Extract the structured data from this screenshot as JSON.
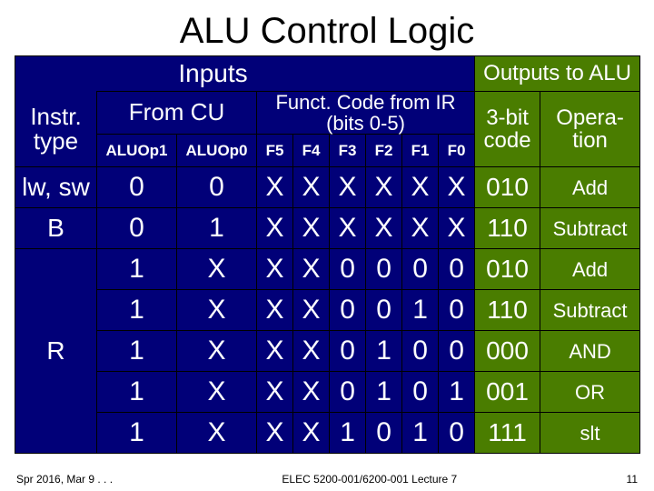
{
  "title": "ALU Control Logic",
  "headers": {
    "inputs": "Inputs",
    "outputs": "Outputs to ALU",
    "instr": "Instr. type",
    "fromcu": "From CU",
    "funct": "Funct. Code from IR (bits 0-5)",
    "aluop1": "ALUOp1",
    "aluop0": "ALUOp0",
    "f5": "F5",
    "f4": "F4",
    "f3": "F3",
    "f2": "F2",
    "f1": "F1",
    "f0": "F0",
    "code3": "3-bit code",
    "oper": "Opera-tion"
  },
  "rows": [
    {
      "instr": "lw, sw",
      "aluop1": "0",
      "aluop0": "0",
      "f5": "X",
      "f4": "X",
      "f3": "X",
      "f2": "X",
      "f1": "X",
      "f0": "X",
      "code": "010",
      "op": "Add"
    },
    {
      "instr": "B",
      "aluop1": "0",
      "aluop0": "1",
      "f5": "X",
      "f4": "X",
      "f3": "X",
      "f2": "X",
      "f1": "X",
      "f0": "X",
      "code": "110",
      "op": "Subtract"
    },
    {
      "instr": "",
      "aluop1": "1",
      "aluop0": "X",
      "f5": "X",
      "f4": "X",
      "f3": "0",
      "f2": "0",
      "f1": "0",
      "f0": "0",
      "code": "010",
      "op": "Add"
    },
    {
      "instr": "",
      "aluop1": "1",
      "aluop0": "X",
      "f5": "X",
      "f4": "X",
      "f3": "0",
      "f2": "0",
      "f1": "1",
      "f0": "0",
      "code": "110",
      "op": "Subtract"
    },
    {
      "instr": "R",
      "aluop1": "1",
      "aluop0": "X",
      "f5": "X",
      "f4": "X",
      "f3": "0",
      "f2": "1",
      "f1": "0",
      "f0": "0",
      "code": "000",
      "op": "AND"
    },
    {
      "instr": "",
      "aluop1": "1",
      "aluop0": "X",
      "f5": "X",
      "f4": "X",
      "f3": "0",
      "f2": "1",
      "f1": "0",
      "f0": "1",
      "code": "001",
      "op": "OR"
    },
    {
      "instr": "",
      "aluop1": "1",
      "aluop0": "X",
      "f5": "X",
      "f4": "X",
      "f3": "1",
      "f2": "0",
      "f1": "1",
      "f0": "0",
      "code": "111",
      "op": "slt"
    }
  ],
  "footer": {
    "left": "Spr 2016, Mar 9 . . .",
    "mid": "ELEC 5200-001/6200-001 Lecture 7",
    "right": "11"
  }
}
